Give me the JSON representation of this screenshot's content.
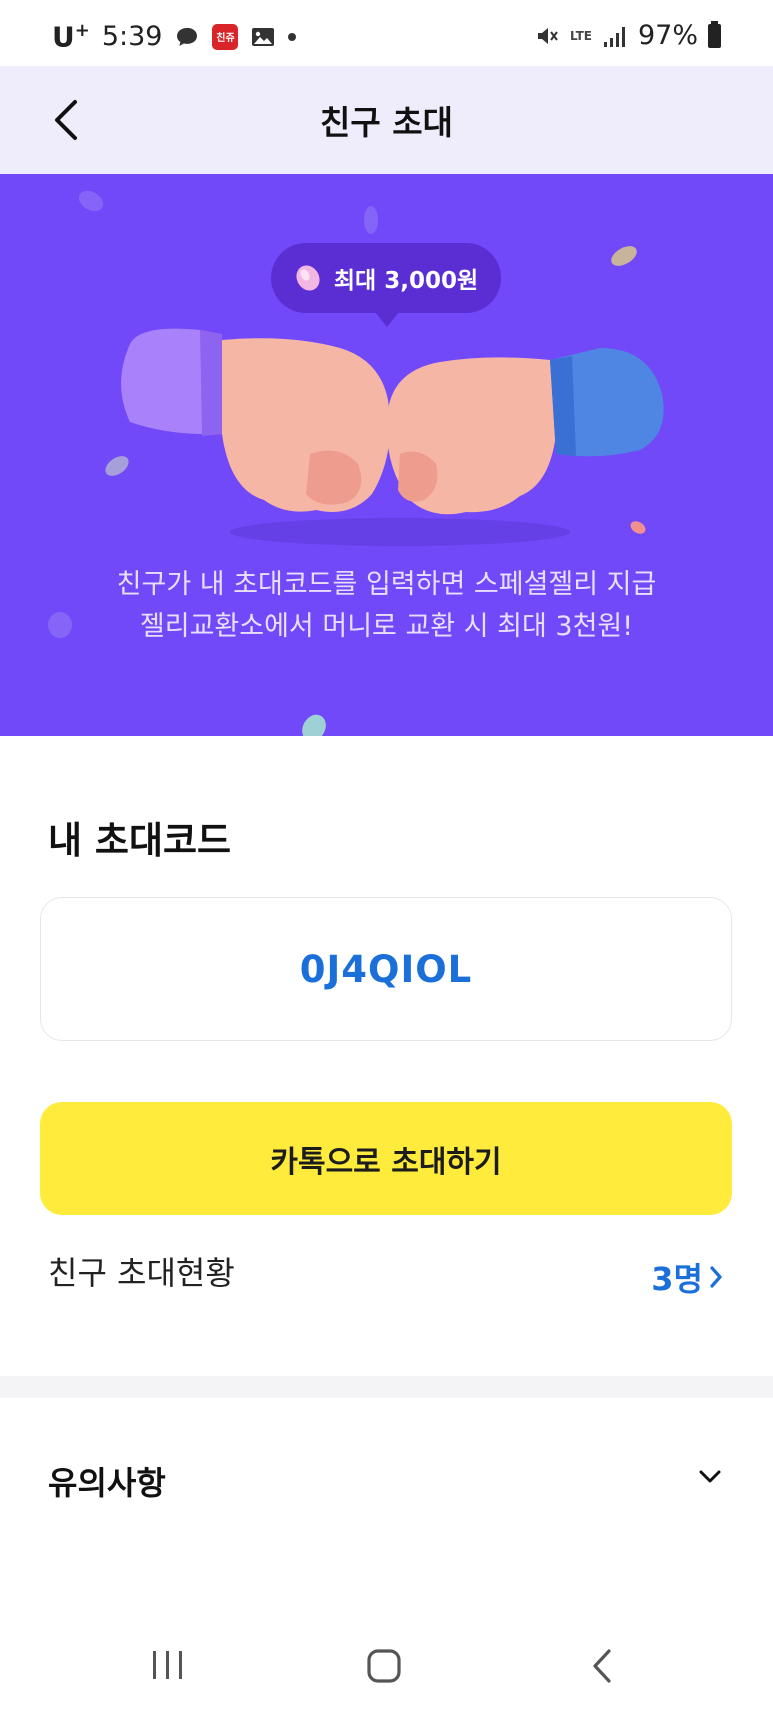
{
  "status_bar": {
    "carrier": "U",
    "carrier_sup": "+",
    "time": "5:39",
    "app_badge": "친쥬",
    "network": "LTE",
    "battery": "97%"
  },
  "header": {
    "title": "친구 초대",
    "back_icon": "chevron-left-icon"
  },
  "banner": {
    "tooltip": "최대 3,000원",
    "description_line1": "친구가 내 초대코드를 입력하면 스페셜젤리 지급",
    "description_line2": "젤리교환소에서 머니로 교환 시 최대 3천원!",
    "colors": {
      "background": "#7149f8",
      "tooltip": "#5a2ed2"
    }
  },
  "invite_code": {
    "section_title": "내 초대코드",
    "code": "0J4QIOL"
  },
  "kakao_button": {
    "label": "카톡으로 초대하기",
    "color": "#ffeb3b"
  },
  "invite_status": {
    "label": "친구 초대현황",
    "count": "3명"
  },
  "notice": {
    "label": "유의사항",
    "icon": "chevron-down-icon"
  },
  "nav": {
    "recents_icon": "recents-icon",
    "home_icon": "home-icon",
    "back_icon": "back-icon"
  }
}
